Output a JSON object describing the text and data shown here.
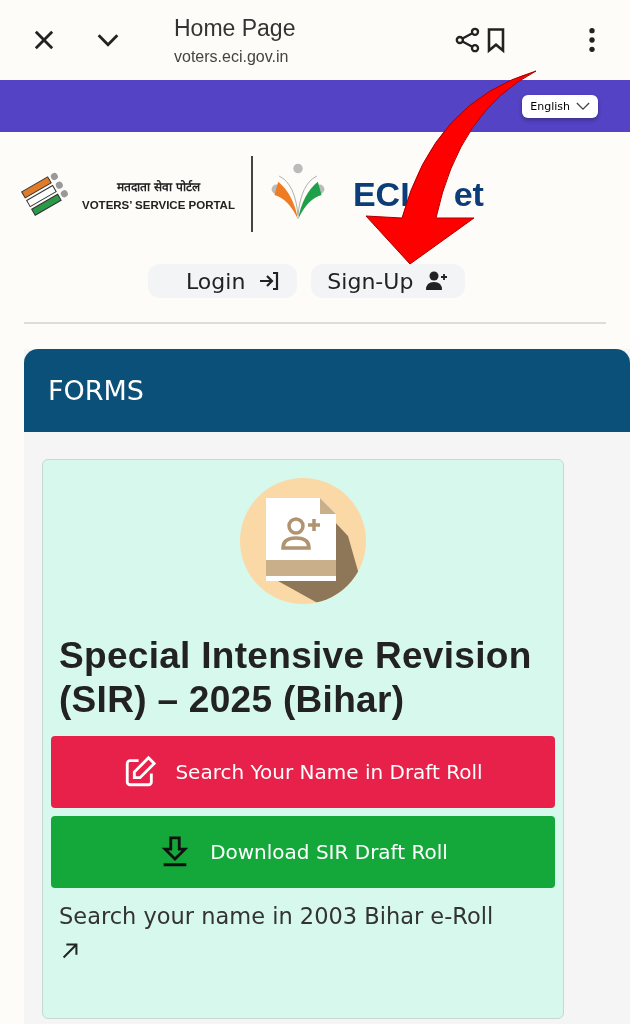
{
  "browser": {
    "title": "Home Page",
    "url": "voters.eci.gov.in"
  },
  "language": {
    "label": "English"
  },
  "header": {
    "portal_hindi": "मतदाता सेवा पोर्टल",
    "portal_english": "VOTERS’ SERVICE PORTAL",
    "brand": [
      "ECI",
      "et"
    ]
  },
  "auth": [
    {
      "kind": "login",
      "label": "Login"
    },
    {
      "kind": "signup",
      "label": "Sign-Up"
    }
  ],
  "forms": {
    "title": "FORMS",
    "card": {
      "heading": "Special Intensive Revision (SIR) – 2025 (Bihar)",
      "buttons": [
        {
          "kind": "search",
          "label": "Search Your Name in Draft Roll",
          "color": "#e8214a"
        },
        {
          "kind": "download",
          "label": "Download SIR Draft Roll",
          "color": "#14a83a"
        }
      ],
      "link": "Search your name in 2003 Bihar e-Roll"
    }
  }
}
